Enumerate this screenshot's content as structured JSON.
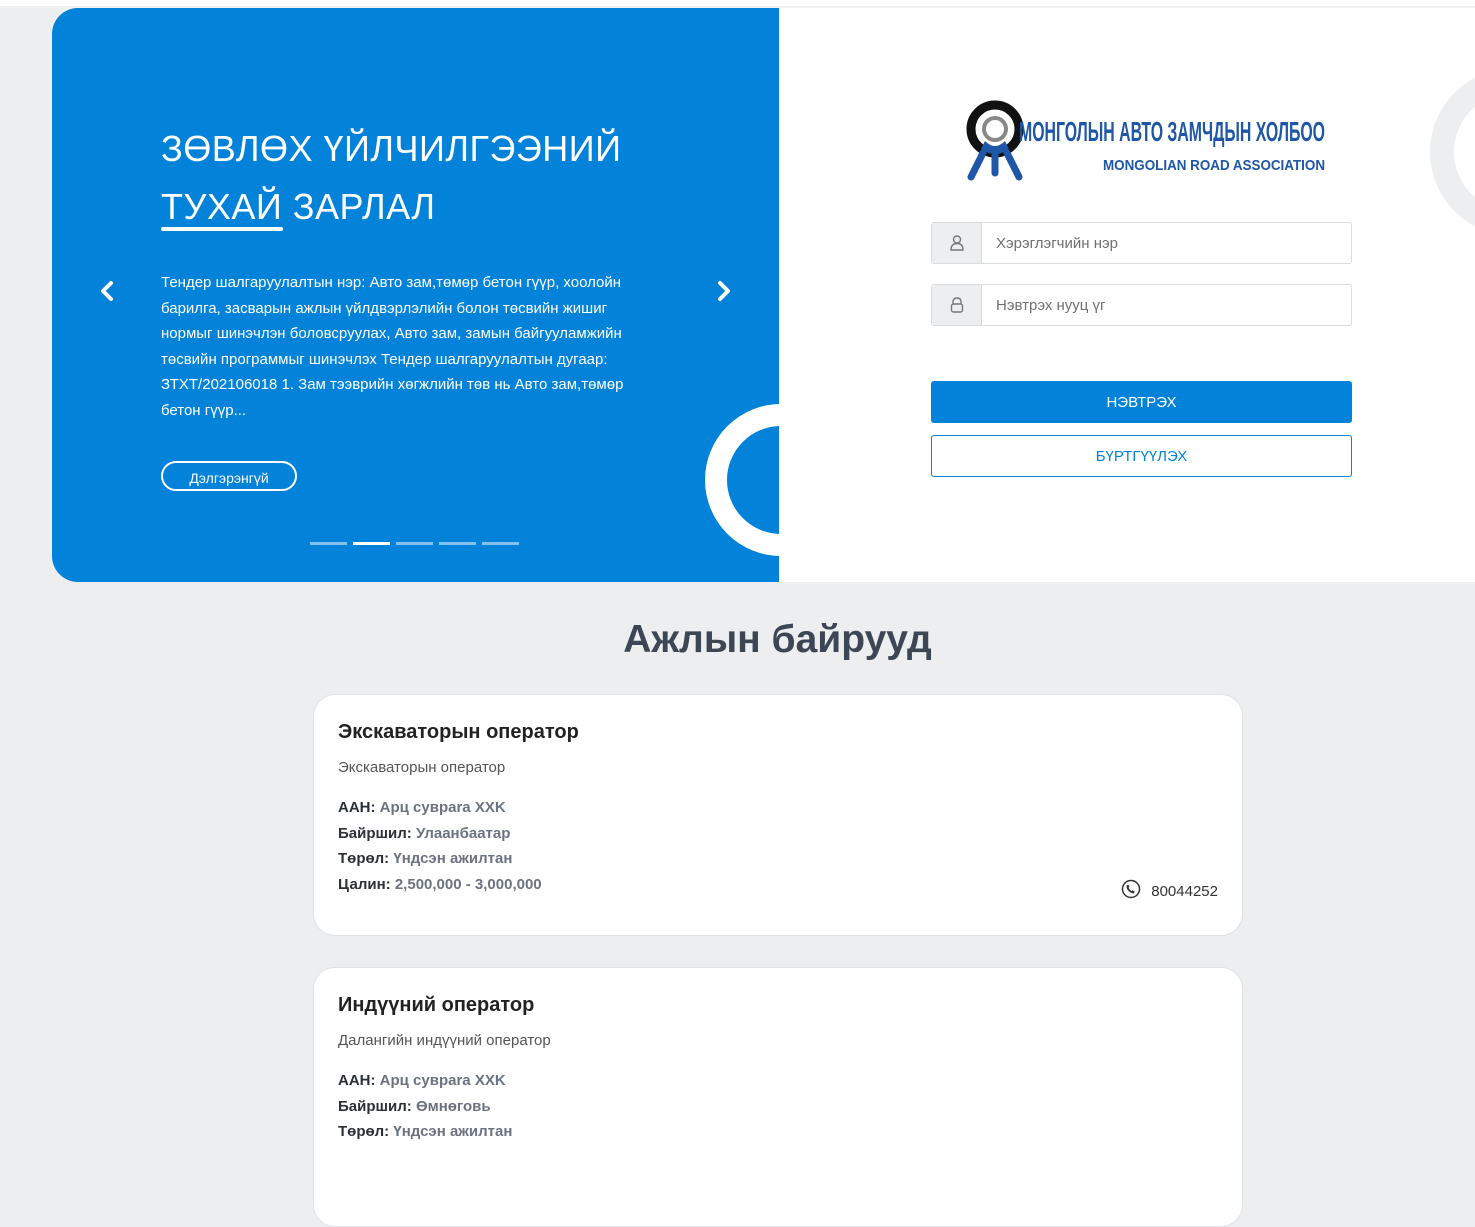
{
  "hero": {
    "title_line1": "ЗӨВЛӨХ ҮЙЛЧИЛГЭЭНИЙ",
    "title_line2": "ТУХАЙ ЗАРЛАЛ",
    "text": "Тендер шалгаруулалтын нэр: Авто зам,төмөр бетон гүүр, хоолойн барилга, засварын ажлын үйлдвэрлэлийн болон төсвийн жишиг нормыг шинэчлэн боловсруулах, Авто зам, замын байгууламжийн төсвийн программыг шинэчлэх Тендер шалгаруулалтын дугаар: ЗТХТ/202106018 1. Зам тээврийн хөгжлийн төв нь Авто зам,төмөр бетон гүүр...",
    "more_button": "Дэлгэрэнгүй",
    "slide_count": 5,
    "active_slide": 2
  },
  "logo": {
    "name_mn": "МОНГОЛЫН АВТО ЗАМЧДЫН ХОЛБОО",
    "name_en": "MONGOLIAN ROAD ASSOCIATION"
  },
  "login": {
    "username_placeholder": "Хэрэглэгчийн нэр",
    "password_placeholder": "Нэвтрэх нууц үг",
    "login_button": "НЭВТРЭХ",
    "register_button": "БҮРТГҮҮЛЭХ"
  },
  "jobs_section": {
    "title": "Ажлын байрууд",
    "jobs": [
      {
        "title": "Экскаваторын оператор",
        "subtitle": "Экскаваторын оператор",
        "company_label": "ААН:",
        "company": "Арц сувраrа XXK",
        "location_label": "Байршил:",
        "location": "Улаанбаатар",
        "type_label": "Төрөл:",
        "type": "Үндсэн ажилтан",
        "salary_label": "Цалин:",
        "salary": "2,500,000 - 3,000,000",
        "phone": "80044252"
      },
      {
        "title": "Индүүний оператор",
        "subtitle": "Далангийн индүүний оператор",
        "company_label": "ААН:",
        "company": "Арц сувраrа XXK",
        "location_label": "Байршил:",
        "location": "Өмнөговь",
        "type_label": "Төрөл:",
        "type": "Үндсэн ажилтан"
      }
    ]
  },
  "colors": {
    "primary": "#0283d9",
    "background": "#eceef0",
    "logo_blue": "#1e56a8"
  }
}
